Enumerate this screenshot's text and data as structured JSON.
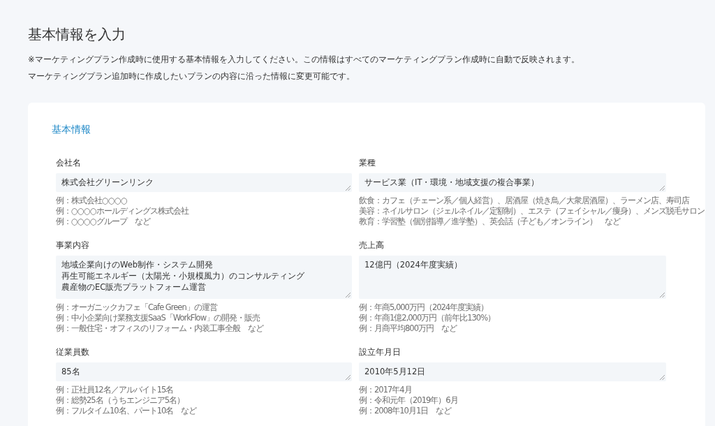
{
  "page": {
    "title": "基本情報を入力",
    "notes": [
      "※マーケティングプラン作成時に使用する基本情報を入力してください。この情報はすべてのマーケティングプラン作成時に自動で反映されます。",
      "マーケティングプラン追加時に作成したいプランの内容に沿った情報に変更可能です。"
    ]
  },
  "section": {
    "title": "基本情報"
  },
  "fields": [
    {
      "label": "会社名",
      "value": "株式会社グリーンリンク",
      "hints": [
        "例：株式会社○○○○",
        "例：○○○○ホールディングス株式会社",
        "例：○○○○グループ　など"
      ]
    },
    {
      "label": "業種",
      "value": "サービス業（IT・環境・地域支援の複合事業）",
      "hints": [
        "飲食：カフェ（チェーン系／個人経営）、居酒屋（焼き鳥／大衆居酒屋）、ラーメン店、寿司店",
        "美容：ネイルサロン（ジェルネイル／定額制）、エステ（フェイシャル／痩身）、メンズ脱毛サロン",
        "教育：学習塾（個別指導／進学塾）、英会話（子ども／オンライン）　など"
      ]
    },
    {
      "label": "事業内容",
      "value": [
        "地域企業向けのWeb制作・システム開発",
        "再生可能エネルギー（太陽光・小規模風力）のコンサルティング",
        "農産物のEC販売プラットフォーム運営"
      ],
      "hints": [
        "例：オーガニックカフェ「Cafe Green」の運営",
        "例：中小企業向け業務支援SaaS「WorkFlow」の開発・販売",
        "例：一般住宅・オフィスのリフォーム・内装工事全般　など"
      ]
    },
    {
      "label": "売上高",
      "value": "12億円（2024年度実績）",
      "hints": [
        "例：年商5,000万円（2024年度実績）",
        "例：年商1億2,000万円（前年比130%）",
        "例：月商平均800万円　など"
      ]
    },
    {
      "label": "従業員数",
      "value": "85名",
      "hints": [
        "例：正社員12名／アルバイト15名",
        "例：総勢25名（うちエンジニア5名）",
        "例：フルタイム10名、パート10名　など"
      ]
    },
    {
      "label": "設立年月日",
      "value": "2010年5月12日",
      "hints": [
        "例：2017年4月",
        "例：令和元年（2019年）6月",
        "例：2008年10月1日　など"
      ]
    }
  ]
}
